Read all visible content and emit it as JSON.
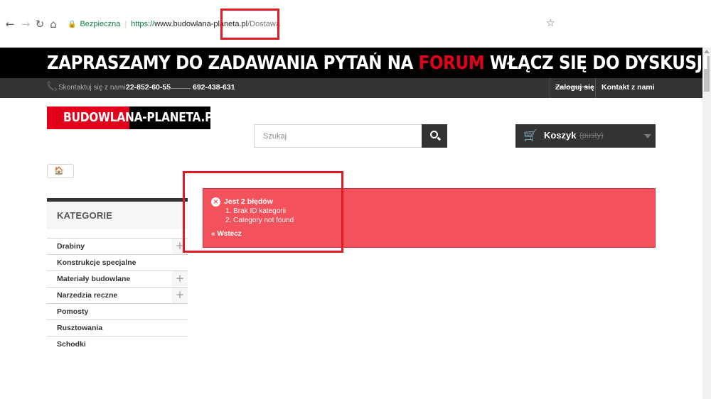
{
  "browser": {
    "secure_label": "Bezpieczna",
    "url_scheme": "https://",
    "url_host": "www.budowlana-planeta.pl",
    "url_path": "/Dostawa"
  },
  "banner": {
    "text_before": "ZAPRASZAMY DO ZADAWANIA PYTAŃ NA ",
    "text_highlight": "FORUM",
    "text_after": " WŁĄCZ SIĘ DO DYSKUSJI",
    "highlight_color": "#e2001a"
  },
  "topnav": {
    "contact_label": "Skontaktuj się z nami:",
    "phone_1": "22-852-60-55",
    "phone_2": "692-438-631",
    "login": "Zaloguj się",
    "contact_link": "Kontakt z nami"
  },
  "logo": {
    "part_red": "BUDOWLANA-",
    "part_black": "PLANETA.PL"
  },
  "search": {
    "placeholder": "Szukaj"
  },
  "cart": {
    "label": "Koszyk",
    "status": "(pusty)"
  },
  "sidebar": {
    "title": "KATEGORIE",
    "items": [
      {
        "label": "Drabiny",
        "expandable": true
      },
      {
        "label": "Konstrukcje specjalne",
        "expandable": false
      },
      {
        "label": "Materiały budowlane",
        "expandable": true
      },
      {
        "label": "Narzedzia reczne",
        "expandable": true
      },
      {
        "label": "Pomosty",
        "expandable": false
      },
      {
        "label": "Rusztowania",
        "expandable": false
      },
      {
        "label": "Schodki",
        "expandable": false
      }
    ]
  },
  "alert": {
    "title": "Jest 2 błędów",
    "errors": [
      "1. Brak ID kategorii",
      "2. Category not found"
    ],
    "back_link": "« Wstecz",
    "color": "#f3515c"
  },
  "icons": {
    "back": "arrow-left-icon",
    "forward": "arrow-right-icon",
    "reload": "reload-icon",
    "home": "home-icon",
    "lock": "lock-icon",
    "bookmark": "star-icon",
    "phone": "phone-icon",
    "search": "search-icon",
    "cart": "cart-icon",
    "error": "error-x-icon"
  }
}
